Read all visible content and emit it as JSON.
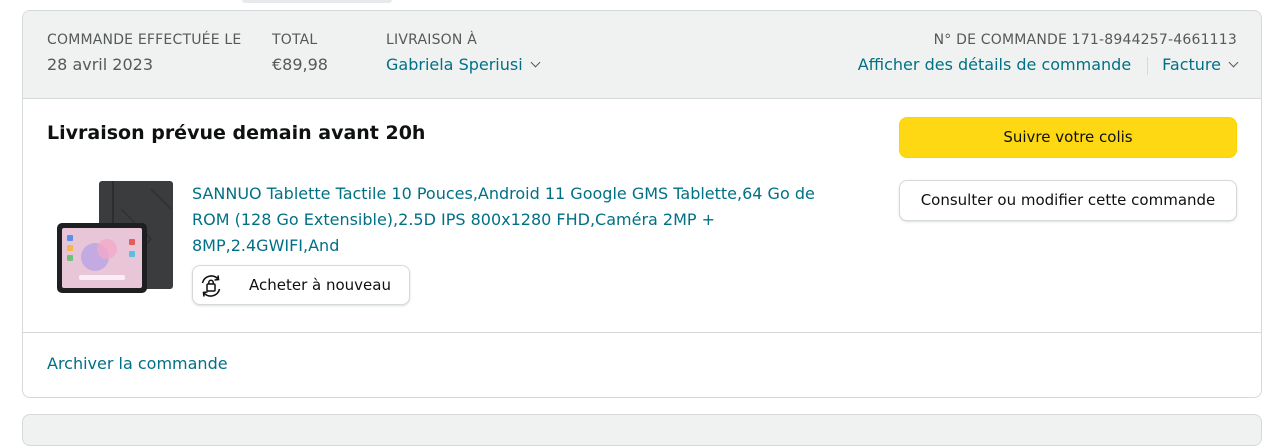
{
  "header": {
    "order_date_label": "COMMANDE EFFECTUÉE LE",
    "order_date": "28 avril 2023",
    "total_label": "TOTAL",
    "total": "€89,98",
    "ship_to_label": "LIVRAISON À",
    "ship_to_name": "Gabriela Speriusi",
    "order_number_label": "N° DE COMMANDE 171-8944257-4661113",
    "order_details_link": "Afficher des détails de commande",
    "invoice_link": "Facture"
  },
  "shipment": {
    "status_title": "Livraison prévue demain avant 20h",
    "product_title": "SANNUO Tablette Tactile 10 Pouces,Android 11 Google GMS Tablette,64 Go de ROM (128 Go Extensible),2.5D IPS 800x1280 FHD,Caméra 2MP + 8MP,2.4GWIFI,And",
    "buy_again_label": "Acheter à nouveau",
    "track_package_label": "Suivre votre colis",
    "view_edit_order_label": "Consulter ou modifier cette commande"
  },
  "footer": {
    "archive_link": "Archiver la commande"
  },
  "colors": {
    "link": "#007185",
    "primary_button": "#ffd814",
    "header_bg": "#f0f2f2",
    "border": "#d5d9d9"
  },
  "icons": {
    "ship_to_dropdown": "chevron-down-icon",
    "invoice_dropdown": "chevron-down-icon",
    "buy_again": "buy-again-cycle-icon"
  }
}
